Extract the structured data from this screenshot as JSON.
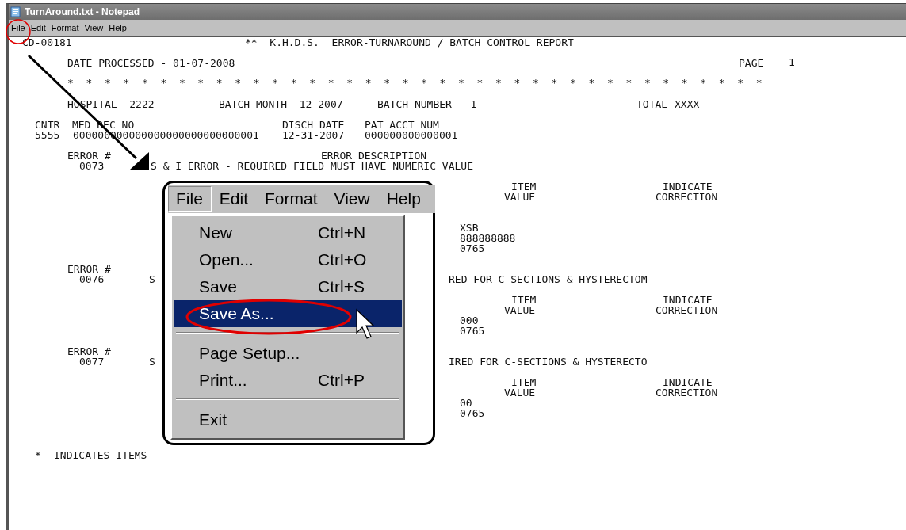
{
  "window": {
    "title": "TurnAround.txt - Notepad"
  },
  "menu": [
    {
      "label": "File",
      "selected": false
    },
    {
      "label": "Edit",
      "selected": false
    },
    {
      "label": "Format",
      "selected": false
    },
    {
      "label": "View",
      "selected": false
    },
    {
      "label": "Help",
      "selected": false
    }
  ],
  "report": [
    {
      "text": "CD-00181"
    },
    {
      "text": "**  K.H.D.S.  ERROR-TURNAROUND / BATCH CONTROL REPORT"
    },
    {
      "text": "DATE PROCESSED - 01-07-2008"
    },
    {
      "text": "PAGE"
    },
    {
      "text": "1"
    },
    {
      "text": "*  *  *  *  *  *  *  *  *  *  *  *  *  *  *  *  *  *  *  *  *  *  *  *  *  *  *  *  *  *  *  *  *  *  *  *  *  *"
    },
    {
      "text": "HOSPITAL  2222"
    },
    {
      "text": "BATCH MONTH  12-2007"
    },
    {
      "text": "BATCH NUMBER - 1"
    },
    {
      "text": "TOTAL"
    },
    {
      "text": "XXXX"
    },
    {
      "text": "CNTR  MED REC NO"
    },
    {
      "text": "DISCH DATE"
    },
    {
      "text": "PAT ACCT NUM"
    },
    {
      "text": "5555"
    },
    {
      "text": "000000000000000000000000000001"
    },
    {
      "text": "12-31-2007"
    },
    {
      "text": "000000000000001"
    },
    {
      "text": "ERROR #"
    },
    {
      "text": "ERROR DESCRIPTION"
    },
    {
      "text": "0073"
    },
    {
      "text": "S & I ERROR - REQUIRED FIELD MUST HAVE NUMERIC VALUE"
    },
    {
      "text": "ITEM"
    },
    {
      "text": "VALUE"
    },
    {
      "text": "INDICATE"
    },
    {
      "text": "CORRECTION"
    },
    {
      "text": "XSB"
    },
    {
      "text": "888888888"
    },
    {
      "text": "0765"
    },
    {
      "text": "ERROR #"
    },
    {
      "text": "0076"
    },
    {
      "text": "S"
    },
    {
      "text": "RED FOR C-SECTIONS & HYSTERECTOM"
    },
    {
      "text": "ITEM"
    },
    {
      "text": "VALUE"
    },
    {
      "text": "INDICATE"
    },
    {
      "text": "CORRECTION"
    },
    {
      "text": "000"
    },
    {
      "text": "0765"
    },
    {
      "text": "ERROR #"
    },
    {
      "text": "0077"
    },
    {
      "text": "S"
    },
    {
      "text": "IRED FOR C-SECTIONS & HYSTERECTO"
    },
    {
      "text": "ITEM"
    },
    {
      "text": "VALUE"
    },
    {
      "text": "INDICATE"
    },
    {
      "text": "CORRECTION"
    },
    {
      "text": "00"
    },
    {
      "text": "0765"
    },
    {
      "text": "-----------"
    },
    {
      "text": "*"
    },
    {
      "text": "INDICATES ITEMS"
    }
  ],
  "callout": {
    "menu": [
      {
        "label": "File",
        "selected": true
      },
      {
        "label": "Edit",
        "selected": false
      },
      {
        "label": "Format",
        "selected": false
      },
      {
        "label": "View",
        "selected": false
      },
      {
        "label": "Help",
        "selected": false
      }
    ],
    "file_menu": [
      {
        "kind": "item",
        "label": "New",
        "shortcut": "Ctrl+N",
        "selected": false
      },
      {
        "kind": "item",
        "label": "Open...",
        "shortcut": "Ctrl+O",
        "selected": false
      },
      {
        "kind": "item",
        "label": "Save",
        "shortcut": "Ctrl+S",
        "selected": false
      },
      {
        "kind": "item",
        "label": "Save As...",
        "selected": true
      },
      {
        "kind": "separator"
      },
      {
        "kind": "item",
        "label": "Page Setup...",
        "selected": false
      },
      {
        "kind": "item",
        "label": "Print...",
        "shortcut": "Ctrl+P",
        "selected": false
      },
      {
        "kind": "separator"
      },
      {
        "kind": "item",
        "label": "Exit",
        "selected": false
      }
    ]
  }
}
